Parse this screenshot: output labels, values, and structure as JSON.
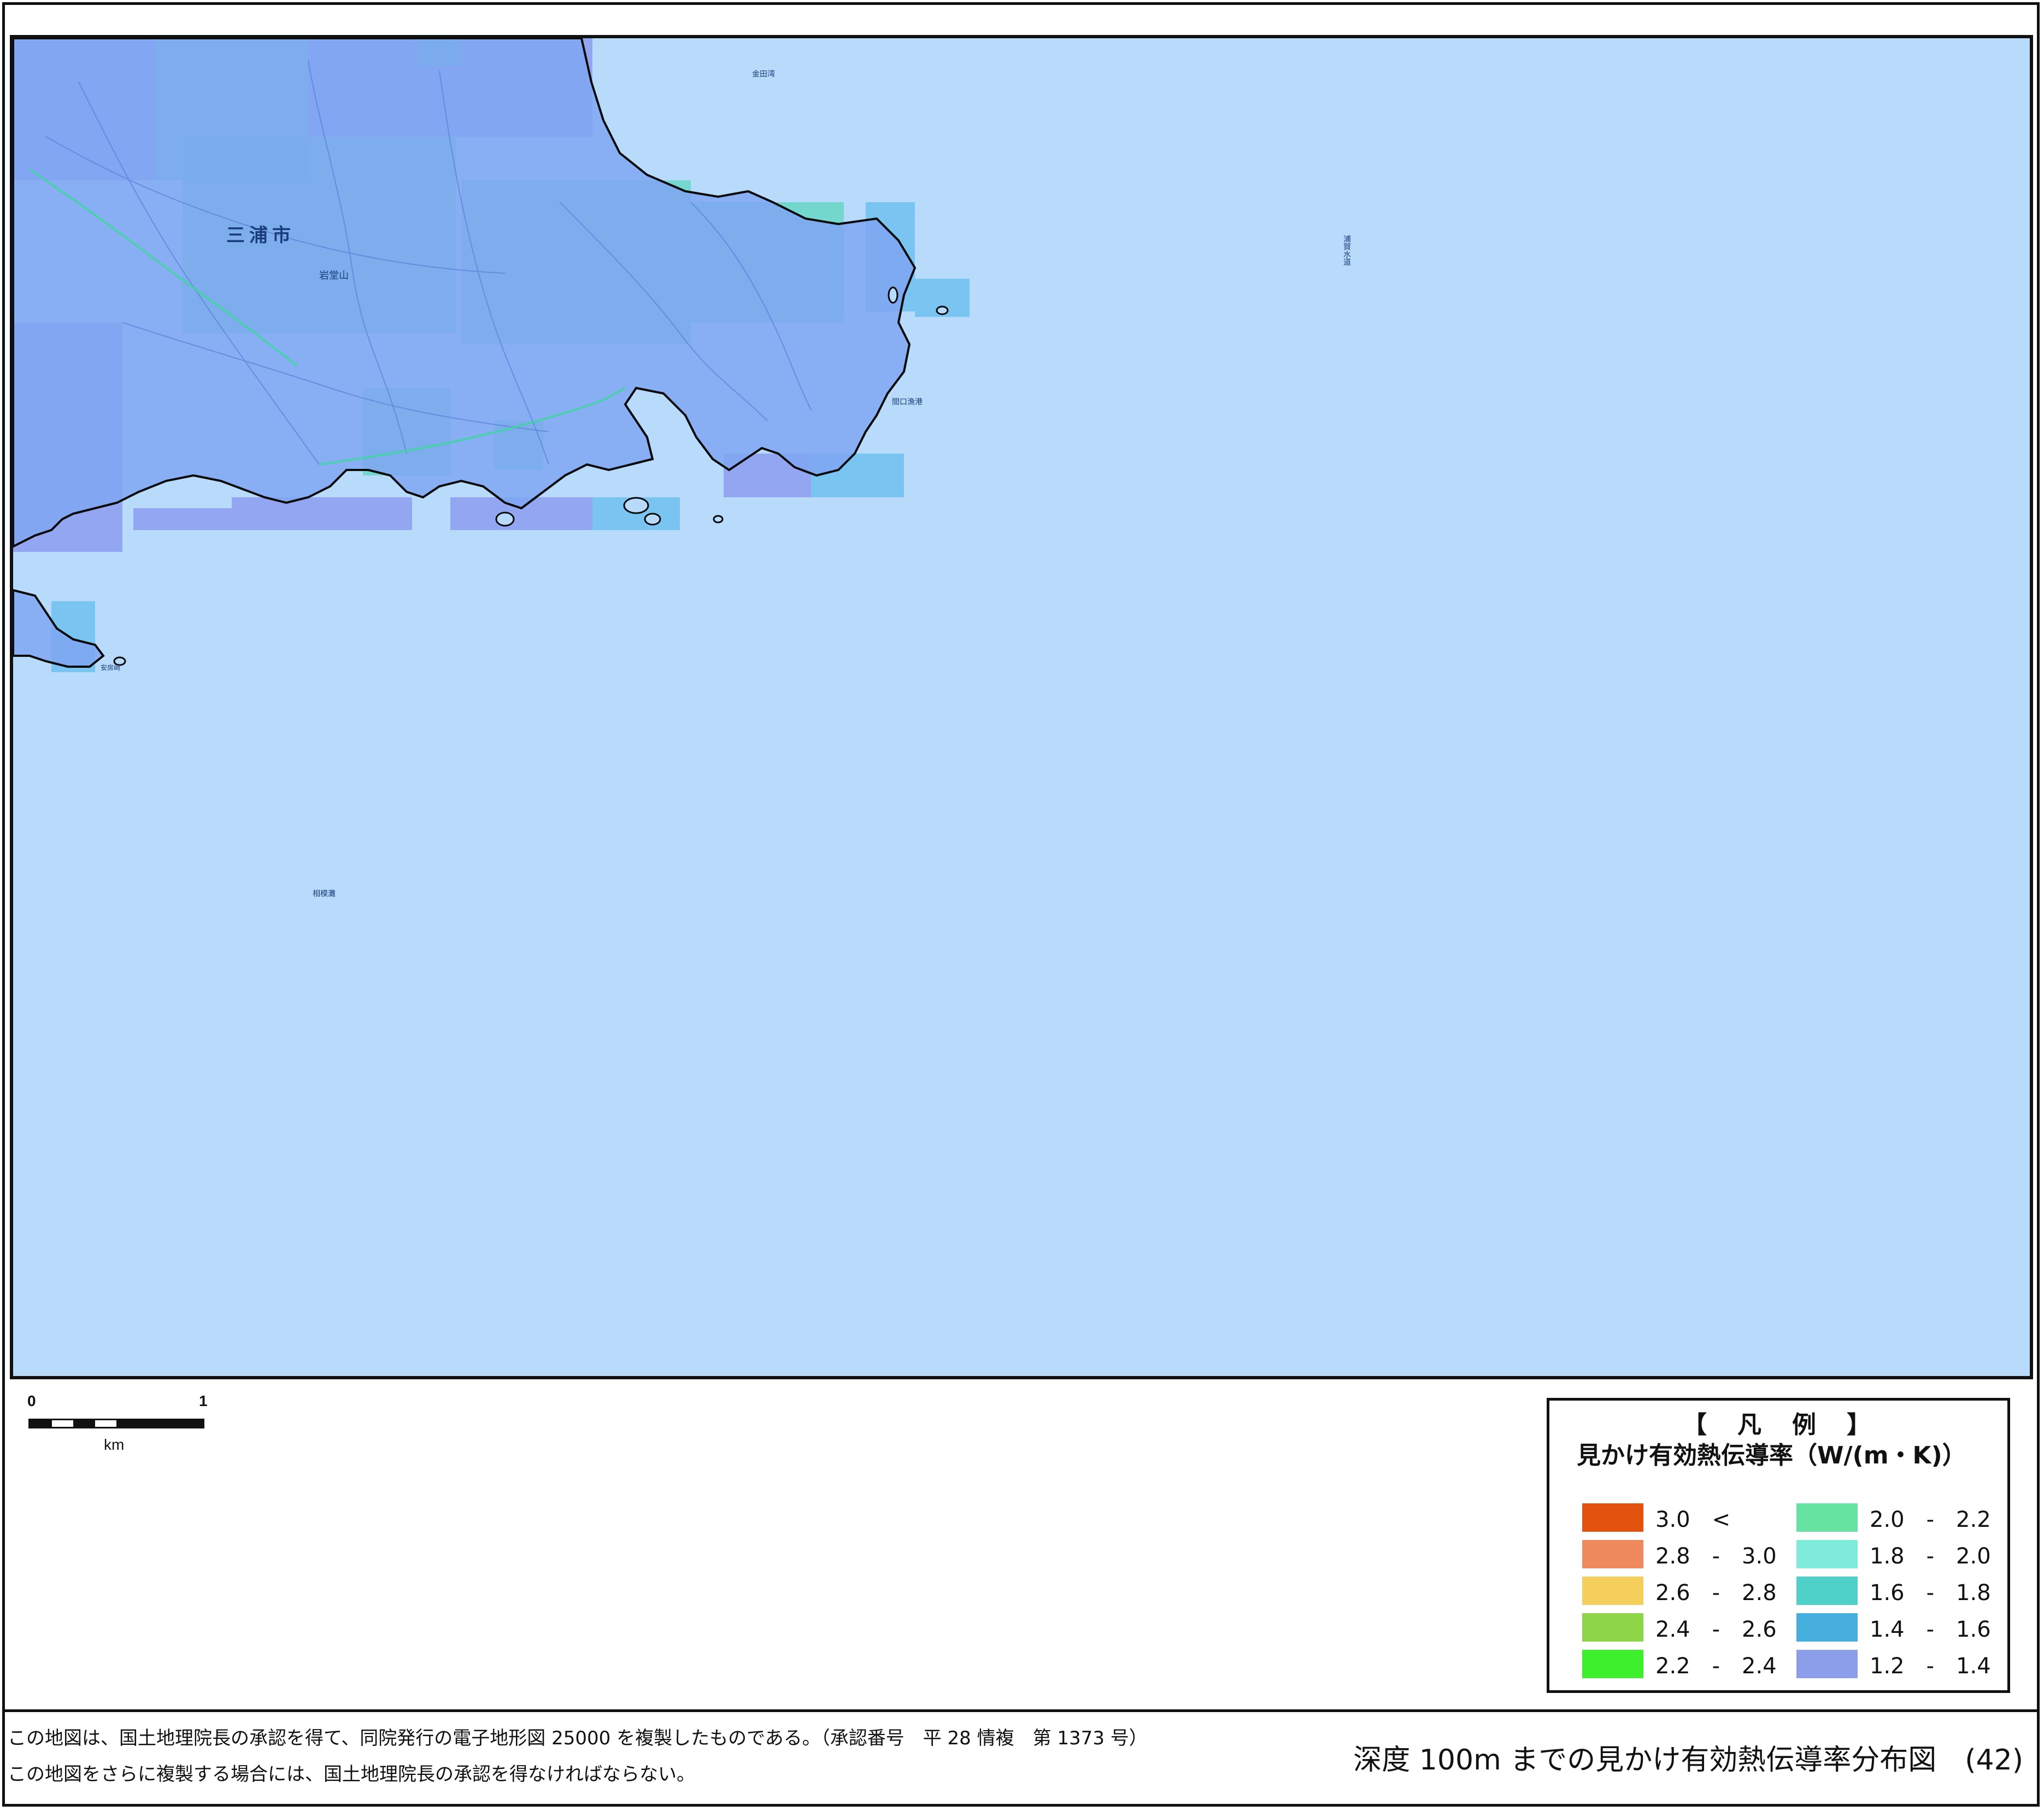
{
  "map": {
    "city_label": "三浦市",
    "mountain_label": "岩堂山",
    "harbor_label": "間口漁港",
    "sea_label": "相模灘",
    "channel_label": "浦賀水道",
    "bay_label": "金田湾",
    "cape_label": "安房崎",
    "colors": {
      "sea": "#b8dbfc",
      "land_base": "#7fa6f2",
      "class_1_2_1_4": "#8b9cee",
      "class_1_4_1_6": "#6fc0f0",
      "class_1_6_1_8": "#66d6c6",
      "coastline": "#0a0a0a"
    }
  },
  "scalebar": {
    "zero": "0",
    "one": "1",
    "unit": "km"
  },
  "legend": {
    "title": "【　凡　例　】",
    "unit_label": "見かけ有効熱伝導率（W/(m・K)）",
    "items": [
      {
        "label": "3.0　<",
        "color": "#e4520f"
      },
      {
        "label": "2.8　-　3.0",
        "color": "#ef8a5f"
      },
      {
        "label": "2.6　-　2.8",
        "color": "#f4cf5c"
      },
      {
        "label": "2.4　-　2.6",
        "color": "#8fd54a"
      },
      {
        "label": "2.2　-　2.4",
        "color": "#3ef02c"
      },
      {
        "label": "2.0　-　2.2",
        "color": "#66e3a0"
      },
      {
        "label": "1.8　-　2.0",
        "color": "#7fecdb"
      },
      {
        "label": "1.6　-　1.8",
        "color": "#4fd0c8"
      },
      {
        "label": "1.4　-　1.6",
        "color": "#45aedd"
      },
      {
        "label": "1.2　-　1.4",
        "color": "#8c9eea"
      }
    ]
  },
  "footer": {
    "note_1": "この地図は、国土地理院長の承認を得て、同院発行の電子地形図 25000 を複製したものである。（承認番号　平 28 情複　第 1373 号）",
    "note_2": "この地図をさらに複製する場合には、国土地理院長の承認を得なければならない。",
    "title": "深度 100m までの見かけ有効熱伝導率分布図　(42)"
  }
}
